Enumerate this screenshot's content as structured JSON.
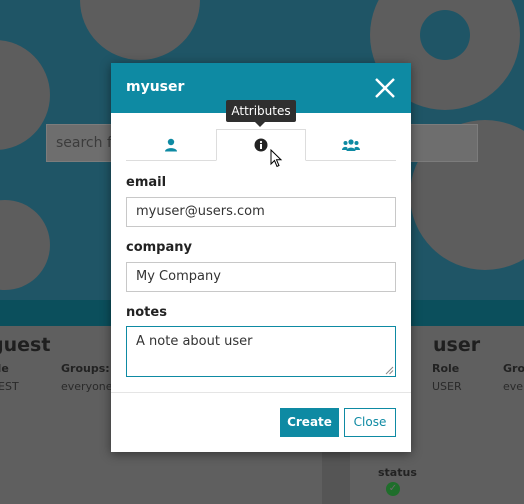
{
  "background": {
    "search_placeholder": "search fo",
    "card_left": {
      "name": "guest",
      "role_label": "ole",
      "role_value": "UEST",
      "groups_label": "Groups:",
      "groups_value": "everyone"
    },
    "card_right": {
      "name": "user",
      "role_label": "Role",
      "role_value": "USER",
      "groups_label": "Gro",
      "groups_value": "ever",
      "status_label": "status"
    }
  },
  "modal": {
    "title": "myuser",
    "tooltip": "Attributes",
    "tabs": [
      {
        "icon": "user-icon"
      },
      {
        "icon": "info-icon"
      },
      {
        "icon": "group-icon"
      }
    ],
    "fields": {
      "email": {
        "label": "email",
        "value": "myuser@users.com"
      },
      "company": {
        "label": "company",
        "value": "My Company"
      },
      "notes": {
        "label": "notes",
        "value": "A note about user"
      }
    },
    "buttons": {
      "create": "Create",
      "close": "Close"
    }
  },
  "colors": {
    "accent": "#0e8aa3",
    "success": "#2db04a"
  }
}
